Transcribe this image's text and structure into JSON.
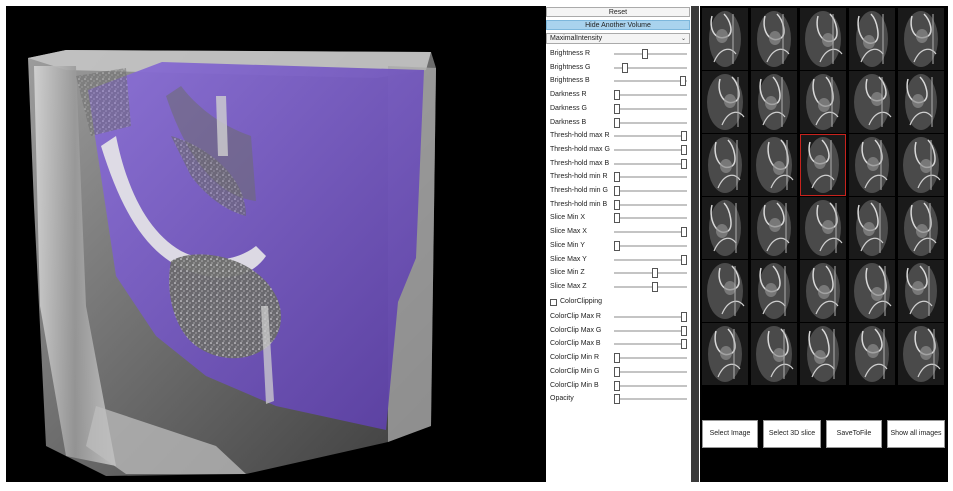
{
  "controls": {
    "reset_label": "Reset",
    "hide_volume_label": "Hide Another Volume",
    "mode_select_value": "MaximalIntensity",
    "colorclipping_label": "ColorClipping",
    "colorclipping_checked": false,
    "sliders": [
      {
        "label": "Brightness R",
        "value": 0.42
      },
      {
        "label": "Brightness G",
        "value": 0.12
      },
      {
        "label": "Brightness B",
        "value": 0.98
      },
      {
        "label": "Darkness R",
        "value": 0.0
      },
      {
        "label": "Darkness G",
        "value": 0.0
      },
      {
        "label": "Darkness B",
        "value": 0.0
      },
      {
        "label": "Thresh-hold max R",
        "value": 1.0
      },
      {
        "label": "Thresh-hold max G",
        "value": 1.0
      },
      {
        "label": "Thresh-hold max  B",
        "value": 1.0
      },
      {
        "label": "Thresh-hold min  R",
        "value": 0.0
      },
      {
        "label": "Thresh-hold min  G",
        "value": 0.0
      },
      {
        "label": "Thresh-hold min B",
        "value": 0.0
      },
      {
        "label": "Slice Min X",
        "value": 0.0
      },
      {
        "label": "Slice Max X",
        "value": 1.0
      },
      {
        "label": "Slice Min Y",
        "value": 0.0
      },
      {
        "label": "Slice Max Y",
        "value": 1.0
      },
      {
        "label": "Slice Min Z",
        "value": 0.57
      },
      {
        "label": "Slice Max Z",
        "value": 0.57
      },
      {
        "label": "ColorClip Max R",
        "value": 1.0
      },
      {
        "label": "ColorClip Max G",
        "value": 1.0
      },
      {
        "label": "ColorClip Max B",
        "value": 1.0
      },
      {
        "label": "ColorClip Min R",
        "value": 0.0
      },
      {
        "label": "ColorClip Min G",
        "value": 0.0
      },
      {
        "label": "ColorClip Min B",
        "value": 0.0
      },
      {
        "label": "Opacity",
        "value": 0.0
      }
    ]
  },
  "thumbnails": {
    "rows": 6,
    "cols": 5,
    "selected": [
      2,
      2
    ]
  },
  "actions": {
    "select_image": "Select Image",
    "select_3d_slice": "Select 3D slice",
    "save_to_file": "SaveToFile",
    "show_all_images": "Show all images"
  },
  "colors": {
    "accent_blue": "#a9d3ee",
    "volume_purple": "#7a5fc4",
    "selected_border": "#c8231d"
  }
}
